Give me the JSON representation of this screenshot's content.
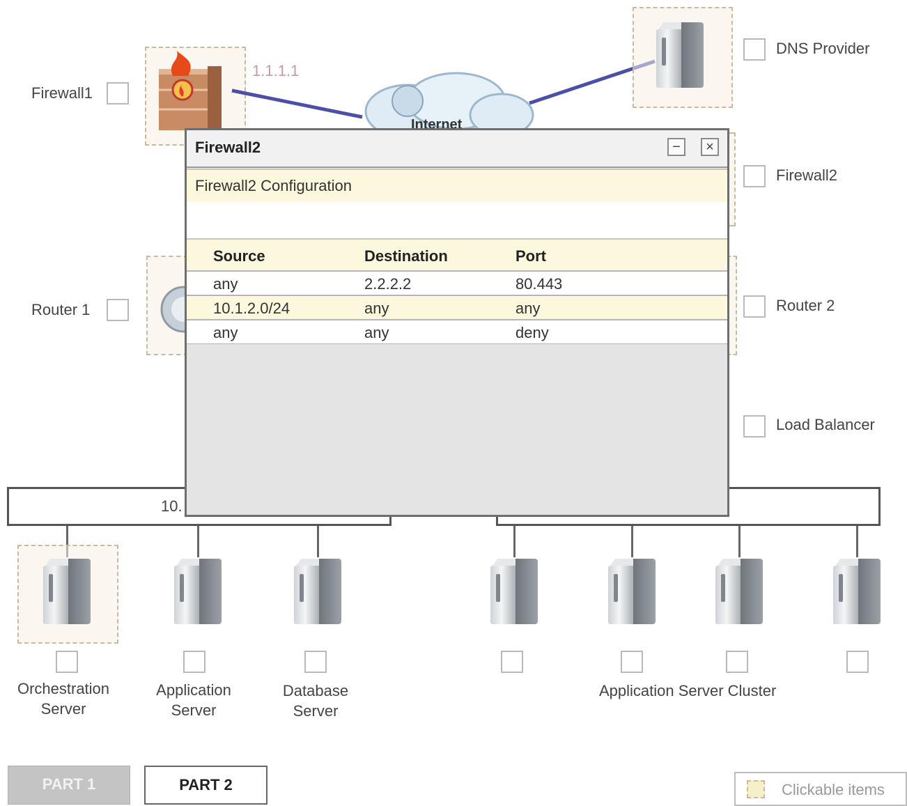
{
  "diagram": {
    "firewall1": {
      "label": "Firewall1",
      "ip": "1.1.1.1"
    },
    "internet": {
      "label": "Internet"
    },
    "dns_provider": {
      "label": "DNS Provider"
    },
    "firewall2": {
      "label": "Firewall2"
    },
    "router1": {
      "label": "Router 1"
    },
    "router2": {
      "label": "Router 2"
    },
    "load_balancer": {
      "label": "Load Balancer"
    },
    "left_network": {
      "label": "10."
    },
    "servers": {
      "orchestration": "Orchestration Server",
      "application": "Application Server",
      "database": "Database Server",
      "cluster": "Application Server Cluster"
    }
  },
  "dialog": {
    "title": "Firewall2",
    "subtitle": "Firewall2 Configuration",
    "minimize_icon": "minimize-icon",
    "close_icon": "close-icon",
    "columns": [
      "Source",
      "Destination",
      "Port"
    ],
    "rows": [
      [
        "any",
        "2.2.2.2",
        "80.443"
      ],
      [
        "10.1.2.0/24",
        "any",
        "any"
      ],
      [
        "any",
        "any",
        "deny"
      ]
    ]
  },
  "tabs": {
    "part1": "PART 1",
    "part2": "PART 2"
  },
  "legend": {
    "label": "Clickable items"
  },
  "colors": {
    "link": "#4b4fa8",
    "highlight": "#fbf8dd",
    "tab_active": "#c4c4c4"
  }
}
